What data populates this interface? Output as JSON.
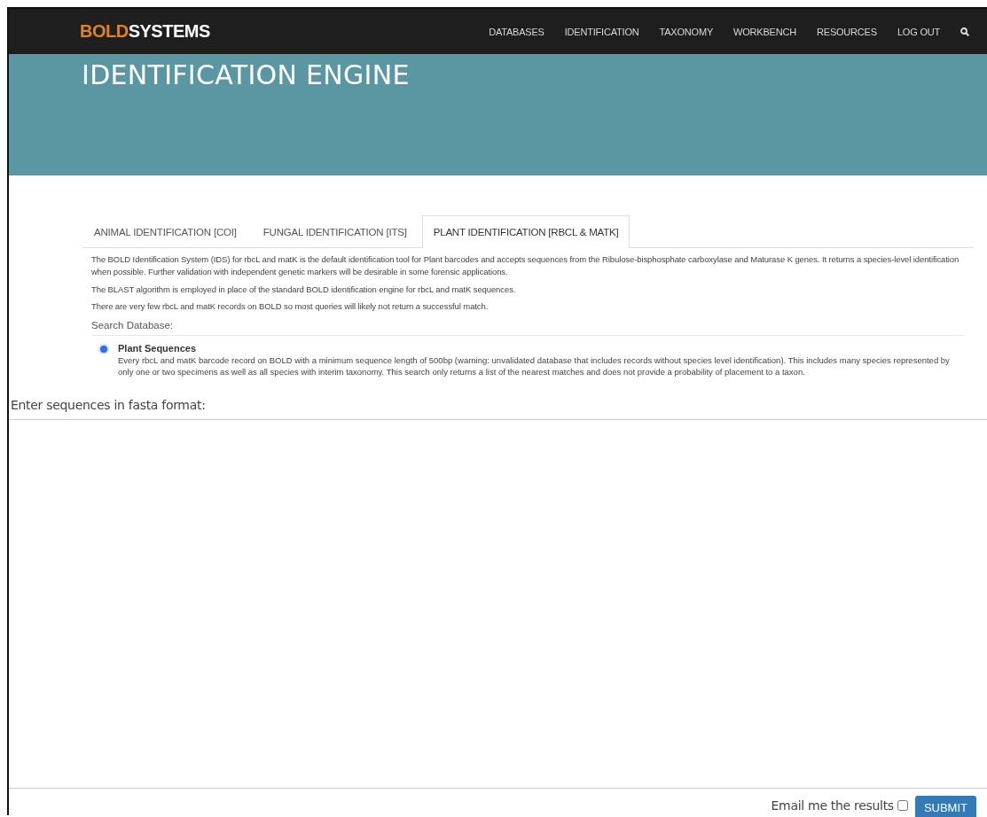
{
  "logo": {
    "accent": "BOLD",
    "rest": "SYSTEMS"
  },
  "nav": {
    "items": [
      "DATABASES",
      "IDENTIFICATION",
      "TAXONOMY",
      "WORKBENCH",
      "RESOURCES",
      "LOG OUT"
    ]
  },
  "banner": {
    "title": "IDENTIFICATION ENGINE"
  },
  "tabs": [
    {
      "label": "ANIMAL IDENTIFICATION [COI]",
      "selected": false
    },
    {
      "label": "FUNGAL IDENTIFICATION [ITS]",
      "selected": false
    },
    {
      "label": "PLANT IDENTIFICATION [RBCL & MATK]",
      "selected": true
    }
  ],
  "description": [
    "The BOLD Identification System (IDS) for rbcL and matK is the default identification tool for Plant barcodes and accepts sequences from the Ribulose-bisphosphate carboxylase and Maturase K genes. It returns a species-level identification when possible. Further validation with independent genetic markers will be desirable in some forensic applications.",
    "The BLAST algorithm is employed in place of the standard BOLD identification engine for rbcL and matK sequences.",
    "There are very few rbcL and matK records on BOLD so most queries will likely not return a successful match."
  ],
  "search_database": {
    "label": "Search Database:",
    "options": [
      {
        "name": "Plant Sequences",
        "selected": true,
        "description": "Every rbcL and matK barcode record on BOLD with a minimum sequence length of 500bp (warning: unvalidated database that includes records without species level identification). This includes many species represented by only one or two specimens as well as all species with interim taxonomy. This search only returns a list of the nearest matches and does not provide a probability of placement to a taxon."
      }
    ]
  },
  "sequences": {
    "label": "Enter sequences in fasta format:"
  },
  "email": {
    "label": "Email me the results",
    "checked": false
  },
  "submit": {
    "label": "SUBMIT"
  }
}
